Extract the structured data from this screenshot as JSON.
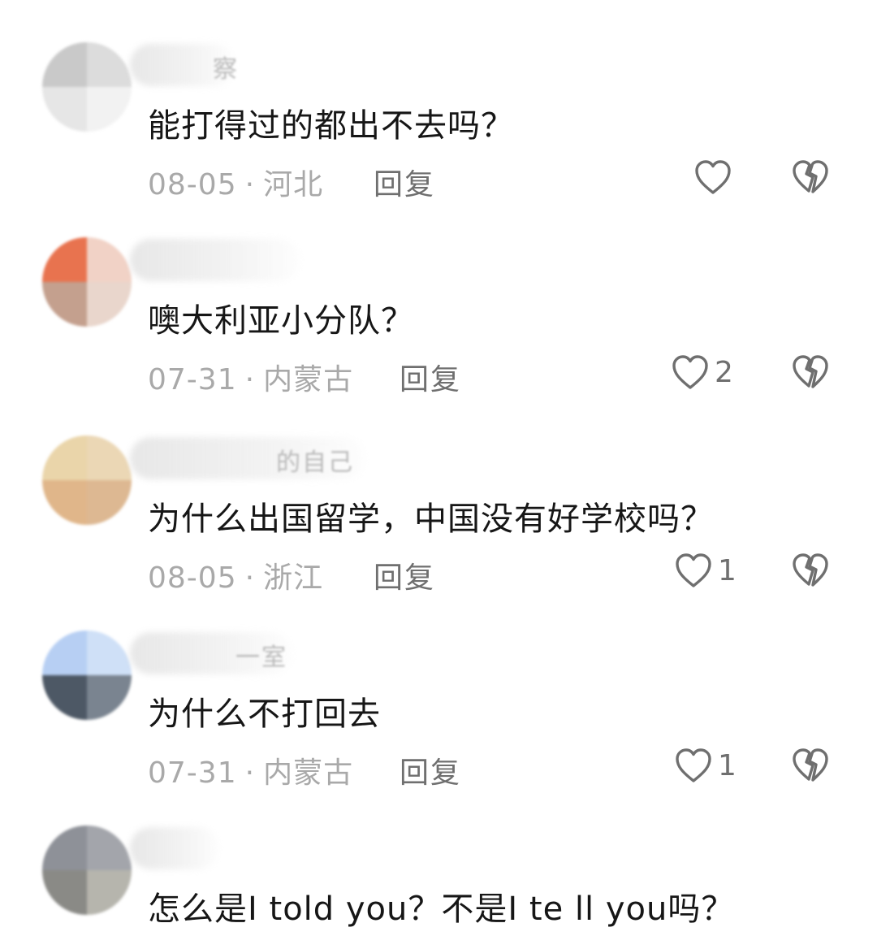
{
  "comments": [
    {
      "name_fragment": "察",
      "text": "能打得过的都出不去吗？",
      "date": "08-05",
      "separator": "·",
      "location": "河北",
      "reply_label": "回复",
      "likes": ""
    },
    {
      "name_fragment": "",
      "text": "噢大利亚小分队？",
      "date": "07-31",
      "separator": "·",
      "location": "内蒙古",
      "reply_label": "回复",
      "likes": "2"
    },
    {
      "name_fragment": "的自己",
      "text": "为什么出国留学，中国没有好学校吗？",
      "date": "08-05",
      "separator": "·",
      "location": "浙江",
      "reply_label": "回复",
      "likes": "1"
    },
    {
      "name_fragment": "一室",
      "text": "为什么不打回去",
      "date": "07-31",
      "separator": "·",
      "location": "内蒙古",
      "reply_label": "回复",
      "likes": "1"
    },
    {
      "name_fragment": "",
      "text": "怎么是I told you？不是I te ll you吗？",
      "date": "",
      "separator": "",
      "location": "",
      "reply_label": "",
      "likes": ""
    }
  ],
  "icons": {
    "like": "heart-outline-icon",
    "dislike": "broken-heart-icon"
  },
  "colors": {
    "text": "#161616",
    "meta": "#a9a9a9",
    "action": "#6f6f6f"
  }
}
